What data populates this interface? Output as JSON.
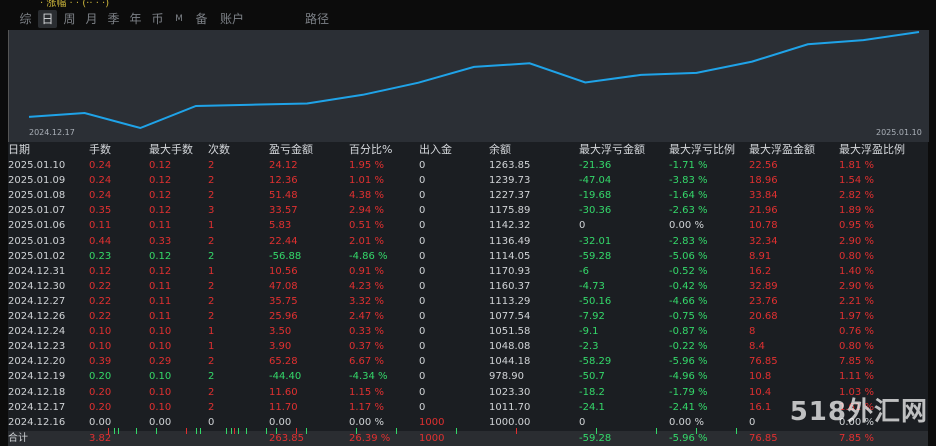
{
  "top_ticker": "· 涨幅 · · (·· · ·)",
  "tabs": [
    "综",
    "日",
    "周",
    "月",
    "季",
    "年",
    "币",
    "M",
    "备",
    "账户",
    "路径"
  ],
  "active_tab": "日",
  "chart_data": {
    "type": "line",
    "x": [
      "2024.12.17",
      "2024.12.18",
      "2024.12.19",
      "2024.12.20",
      "2024.12.23",
      "2024.12.24",
      "2024.12.26",
      "2024.12.27",
      "2024.12.30",
      "2024.12.31",
      "2025.01.02",
      "2025.01.03",
      "2025.01.06",
      "2025.01.07",
      "2025.01.08",
      "2025.01.09",
      "2025.01.10"
    ],
    "y": [
      1011.7,
      1023.3,
      978.9,
      1044.18,
      1048.08,
      1051.58,
      1077.54,
      1113.29,
      1160.37,
      1170.93,
      1114.05,
      1136.49,
      1142.32,
      1175.89,
      1227.37,
      1239.73,
      1263.85
    ],
    "start_label": "2024.12.17",
    "end_label": "2025.01.10",
    "line_color": "#1fa3e8"
  },
  "table": {
    "headers": [
      "日期",
      "手数",
      "最大手数",
      "次数",
      "盈亏金额",
      "百分比%",
      "出入金",
      "余额",
      "最大浮亏金额",
      "最大浮亏比例",
      "最大浮盈金额",
      "最大浮盈比例"
    ],
    "rows": [
      {
        "c": [
          "r",
          "r",
          "r",
          "r",
          "r",
          "w",
          "w",
          "g",
          "g",
          "r",
          "r"
        ],
        "v": [
          "2025.01.10",
          "0.24",
          "0.12",
          "2",
          "24.12",
          "1.95 %",
          "0",
          "1263.85",
          "-21.36",
          "-1.71 %",
          "22.56",
          "1.81 %"
        ]
      },
      {
        "c": [
          "r",
          "r",
          "r",
          "r",
          "r",
          "w",
          "w",
          "g",
          "g",
          "r",
          "r"
        ],
        "v": [
          "2025.01.09",
          "0.24",
          "0.12",
          "2",
          "12.36",
          "1.01 %",
          "0",
          "1239.73",
          "-47.04",
          "-3.83 %",
          "18.96",
          "1.54 %"
        ]
      },
      {
        "c": [
          "r",
          "r",
          "r",
          "r",
          "r",
          "w",
          "w",
          "g",
          "g",
          "r",
          "r"
        ],
        "v": [
          "2025.01.08",
          "0.24",
          "0.12",
          "2",
          "51.48",
          "4.38 %",
          "0",
          "1227.37",
          "-19.68",
          "-1.64 %",
          "33.84",
          "2.82 %"
        ]
      },
      {
        "c": [
          "r",
          "r",
          "r",
          "r",
          "r",
          "w",
          "w",
          "g",
          "g",
          "r",
          "r"
        ],
        "v": [
          "2025.01.07",
          "0.35",
          "0.12",
          "3",
          "33.57",
          "2.94 %",
          "0",
          "1175.89",
          "-30.36",
          "-2.63 %",
          "21.96",
          "1.89 %"
        ]
      },
      {
        "c": [
          "r",
          "r",
          "r",
          "r",
          "r",
          "w",
          "w",
          "w",
          "w",
          "r",
          "r"
        ],
        "v": [
          "2025.01.06",
          "0.11",
          "0.11",
          "1",
          "5.83",
          "0.51 %",
          "0",
          "1142.32",
          "0",
          "0.00 %",
          "10.78",
          "0.95 %"
        ]
      },
      {
        "c": [
          "r",
          "r",
          "r",
          "r",
          "r",
          "w",
          "w",
          "g",
          "g",
          "r",
          "r"
        ],
        "v": [
          "2025.01.03",
          "0.44",
          "0.33",
          "2",
          "22.44",
          "2.01 %",
          "0",
          "1136.49",
          "-32.01",
          "-2.83 %",
          "32.34",
          "2.90 %"
        ]
      },
      {
        "c": [
          "g",
          "g",
          "g",
          "g",
          "g",
          "w",
          "w",
          "g",
          "g",
          "r",
          "r"
        ],
        "v": [
          "2025.01.02",
          "0.23",
          "0.12",
          "2",
          "-56.88",
          "-4.86 %",
          "0",
          "1114.05",
          "-59.28",
          "-5.06 %",
          "8.91",
          "0.80 %"
        ]
      },
      {
        "c": [
          "r",
          "r",
          "r",
          "r",
          "r",
          "w",
          "w",
          "g",
          "g",
          "r",
          "r"
        ],
        "v": [
          "2024.12.31",
          "0.12",
          "0.12",
          "1",
          "10.56",
          "0.91 %",
          "0",
          "1170.93",
          "-6",
          "-0.52 %",
          "16.2",
          "1.40 %"
        ]
      },
      {
        "c": [
          "r",
          "r",
          "r",
          "r",
          "r",
          "w",
          "w",
          "g",
          "g",
          "r",
          "r"
        ],
        "v": [
          "2024.12.30",
          "0.22",
          "0.11",
          "2",
          "47.08",
          "4.23 %",
          "0",
          "1160.37",
          "-4.73",
          "-0.42 %",
          "32.89",
          "2.90 %"
        ]
      },
      {
        "c": [
          "r",
          "r",
          "r",
          "r",
          "r",
          "w",
          "w",
          "g",
          "g",
          "r",
          "r"
        ],
        "v": [
          "2024.12.27",
          "0.22",
          "0.11",
          "2",
          "35.75",
          "3.32 %",
          "0",
          "1113.29",
          "-50.16",
          "-4.66 %",
          "23.76",
          "2.21 %"
        ]
      },
      {
        "c": [
          "r",
          "r",
          "r",
          "r",
          "r",
          "w",
          "w",
          "g",
          "g",
          "r",
          "r"
        ],
        "v": [
          "2024.12.26",
          "0.22",
          "0.11",
          "2",
          "25.96",
          "2.47 %",
          "0",
          "1077.54",
          "-7.92",
          "-0.75 %",
          "20.68",
          "1.97 %"
        ]
      },
      {
        "c": [
          "r",
          "r",
          "r",
          "r",
          "r",
          "w",
          "w",
          "g",
          "g",
          "r",
          "r"
        ],
        "v": [
          "2024.12.24",
          "0.10",
          "0.10",
          "1",
          "3.50",
          "0.33 %",
          "0",
          "1051.58",
          "-9.1",
          "-0.87 %",
          "8",
          "0.76 %"
        ]
      },
      {
        "c": [
          "r",
          "r",
          "r",
          "r",
          "r",
          "w",
          "w",
          "g",
          "g",
          "r",
          "r"
        ],
        "v": [
          "2024.12.23",
          "0.10",
          "0.10",
          "1",
          "3.90",
          "0.37 %",
          "0",
          "1048.08",
          "-2.3",
          "-0.22 %",
          "8.4",
          "0.80 %"
        ]
      },
      {
        "c": [
          "r",
          "r",
          "r",
          "r",
          "r",
          "w",
          "w",
          "g",
          "g",
          "r",
          "r"
        ],
        "v": [
          "2024.12.20",
          "0.39",
          "0.29",
          "2",
          "65.28",
          "6.67 %",
          "0",
          "1044.18",
          "-58.29",
          "-5.96 %",
          "76.85",
          "7.85 %"
        ]
      },
      {
        "c": [
          "g",
          "g",
          "g",
          "g",
          "g",
          "w",
          "w",
          "g",
          "g",
          "r",
          "r"
        ],
        "v": [
          "2024.12.19",
          "0.20",
          "0.10",
          "2",
          "-44.40",
          "-4.34 %",
          "0",
          "978.90",
          "-50.7",
          "-4.96 %",
          "10.8",
          "1.11 %"
        ]
      },
      {
        "c": [
          "r",
          "r",
          "r",
          "r",
          "r",
          "w",
          "w",
          "g",
          "g",
          "r",
          "r"
        ],
        "v": [
          "2024.12.18",
          "0.20",
          "0.10",
          "2",
          "11.60",
          "1.15 %",
          "0",
          "1023.30",
          "-18.2",
          "-1.79 %",
          "10.4",
          "1.03 %"
        ]
      },
      {
        "c": [
          "r",
          "r",
          "r",
          "r",
          "r",
          "w",
          "w",
          "g",
          "g",
          "r",
          "r"
        ],
        "v": [
          "2024.12.17",
          "0.20",
          "0.10",
          "2",
          "11.70",
          "1.17 %",
          "0",
          "1011.70",
          "-24.1",
          "-2.41 %",
          "16.1",
          "1.61 %"
        ]
      },
      {
        "c": [
          "w",
          "w",
          "w",
          "w",
          "w",
          "r",
          "w",
          "w",
          "w",
          "w",
          "w"
        ],
        "v": [
          "2024.12.16",
          "0.00",
          "0.00",
          "0",
          "0.00",
          "0.00 %",
          "1000",
          "1000.00",
          "0",
          "0.00 %",
          "0",
          "0.00 %"
        ]
      }
    ],
    "total": {
      "c": [
        "r",
        "w",
        "w",
        "r",
        "r",
        "r",
        "w",
        "g",
        "g",
        "r",
        "r"
      ],
      "v": [
        "合计",
        "3.82",
        "",
        "",
        "263.85",
        "26.39 %",
        "1000",
        "",
        "-59.28",
        "-5.96 %",
        "76.85",
        "7.85 %"
      ]
    }
  },
  "watermark": "518外汇网"
}
